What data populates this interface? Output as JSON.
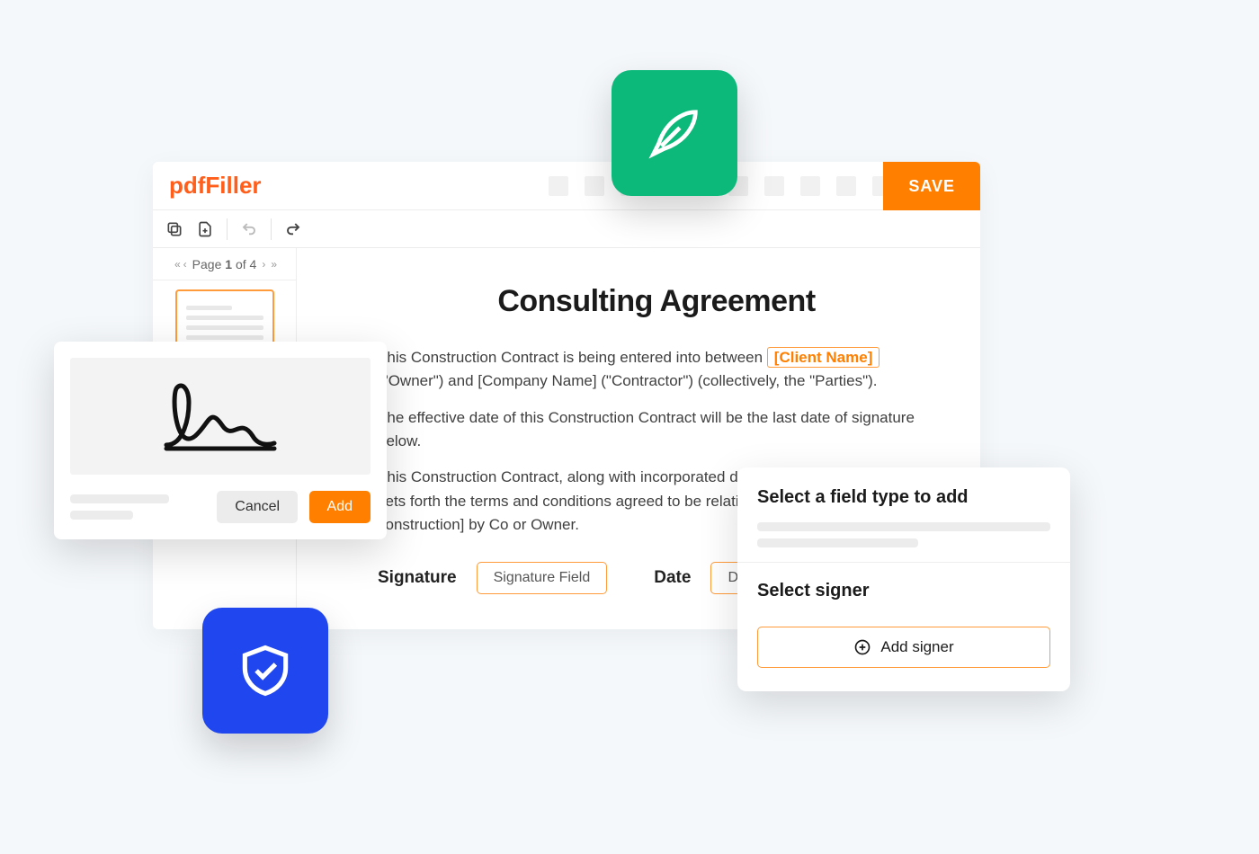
{
  "brand": {
    "prefix": "pdf",
    "suffix": "Filler"
  },
  "toolbar": {
    "save": "SAVE"
  },
  "pager": {
    "prefix": "Page ",
    "current": "1",
    "of": " of ",
    "total": "4"
  },
  "doc": {
    "title": "Consulting Agreement",
    "p1a": "This Construction Contract is being entered into between ",
    "p1_placeholder": "[Client Name]",
    "p1b": " (\"Owner\") and  [Company Name]  (\"Contractor\") (collectively, the \"Parties\").",
    "p2": "The effective date of this Construction Contract will be the last date of signature below.",
    "p3": "This Construction Contract, along with incorporated documents referenced herein, sets forth the terms and conditions agreed to be relating to construction of [type of construction] by Co or Owner.",
    "sig_label": "Signature",
    "sig_field": "Signature Field",
    "date_label": "Date",
    "date_field": "D"
  },
  "sigpop": {
    "cancel": "Cancel",
    "add": "Add"
  },
  "signer": {
    "title": "Select a field type to add",
    "subtitle": "Select signer",
    "add": "Add signer"
  }
}
